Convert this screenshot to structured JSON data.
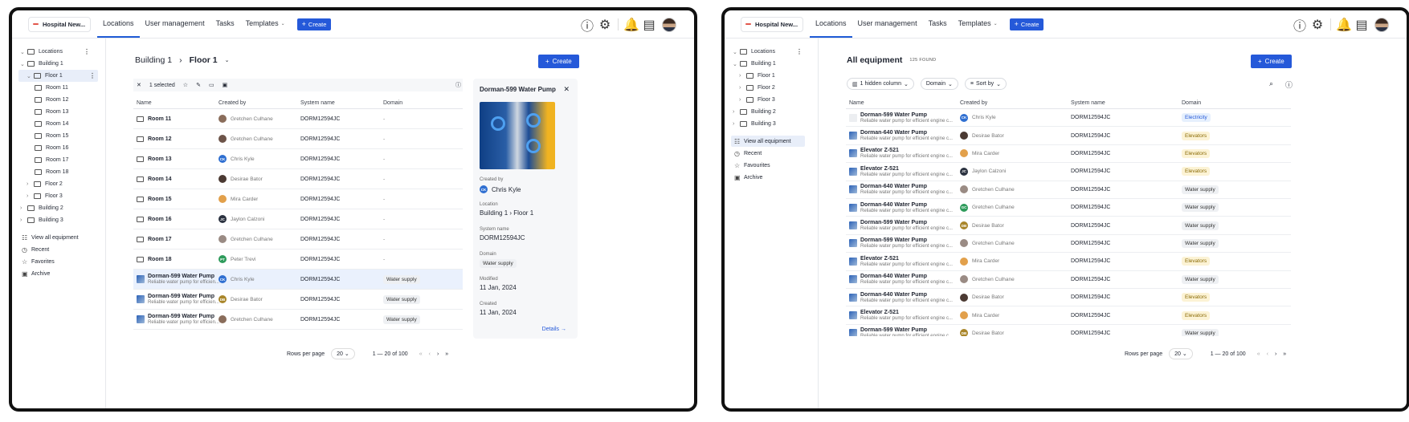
{
  "brand": "Hospital New...",
  "nav": [
    {
      "label": "Locations"
    },
    {
      "label": "User management"
    },
    {
      "label": "Tasks"
    },
    {
      "label": "Templates"
    }
  ],
  "create_label": "Create",
  "left": {
    "tree": {
      "root": "Locations",
      "b1": "Building 1",
      "f1": "Floor 1",
      "rooms": [
        "Room 11",
        "Room 12",
        "Room 13",
        "Room 14",
        "Room 15",
        "Room 16",
        "Room 17",
        "Room 18"
      ],
      "f2": "Floor 2",
      "f3": "Floor 3",
      "b2": "Building 2",
      "b3": "Building 3"
    },
    "side_items": [
      "View all equipment",
      "Recent",
      "Favorites",
      "Archive"
    ],
    "breadcrumb": {
      "a": "Building 1",
      "b": "Floor 1"
    },
    "toolbar": {
      "selected": "1 selected"
    },
    "columns": [
      "Name",
      "Created by",
      "System name",
      "Domain"
    ],
    "rows": [
      {
        "name": "Room 11",
        "sub": "",
        "by": "Gretchen Culhane",
        "sys": "DORM12594JC",
        "domain": "-",
        "kind": "folder",
        "init": "",
        "col": "#8a6d5b"
      },
      {
        "name": "Room 12",
        "sub": "",
        "by": "Gretchen Culhane",
        "sys": "DORM12594JC",
        "domain": "-",
        "kind": "folder",
        "init": "",
        "col": "#6d5449"
      },
      {
        "name": "Room 13",
        "sub": "",
        "by": "Chris Kyle",
        "sys": "DORM12594JC",
        "domain": "-",
        "kind": "folder",
        "init": "CK",
        "col": "#2f6fd1"
      },
      {
        "name": "Room 14",
        "sub": "",
        "by": "Desirae Bator",
        "sys": "DORM12594JC",
        "domain": "-",
        "kind": "folder",
        "init": "",
        "col": "#4b3a33"
      },
      {
        "name": "Room 15",
        "sub": "",
        "by": "Mira Carder",
        "sys": "DORM12594JC",
        "domain": "-",
        "kind": "folder",
        "init": "",
        "col": "#e2a04b"
      },
      {
        "name": "Room 16",
        "sub": "",
        "by": "Jaylon Calzoni",
        "sys": "DORM12594JC",
        "domain": "-",
        "kind": "folder",
        "init": "JC",
        "col": "#2b3240"
      },
      {
        "name": "Room 17",
        "sub": "",
        "by": "Gretchen Culhane",
        "sys": "DORM12594JC",
        "domain": "-",
        "kind": "folder",
        "init": "",
        "col": "#9a8b84"
      },
      {
        "name": "Room 18",
        "sub": "",
        "by": "Peter Trevi",
        "sys": "DORM12594JC",
        "domain": "-",
        "kind": "folder",
        "init": "PT",
        "col": "#2e9b5b"
      },
      {
        "name": "Dorman-599 Water Pump",
        "sub": "Reliable water pump for efficien...",
        "by": "Chris Kyle",
        "sys": "DORM12594JC",
        "domain": "Water supply",
        "kind": "thumb",
        "init": "CK",
        "col": "#2f6fd1"
      },
      {
        "name": "Dorman-599 Water Pump",
        "sub": "Reliable water pump for efficien...",
        "by": "Desirae Bator",
        "sys": "DORM12594JC",
        "domain": "Water supply",
        "kind": "thumb",
        "init": "DB",
        "col": "#a9862a"
      },
      {
        "name": "Dorman-599 Water Pump",
        "sub": "Reliable water pump for efficien...",
        "by": "Gretchen Culhane",
        "sys": "DORM12594JC",
        "domain": "Water supply",
        "kind": "thumb",
        "init": "",
        "col": "#8a6d5b"
      }
    ],
    "panel": {
      "title": "Dorman-599 Water Pump",
      "created_by_label": "Created by",
      "created_by": "Chris Kyle",
      "created_init": "CK",
      "location_label": "Location",
      "location": "Building 1 › Floor 1",
      "sys_label": "System name",
      "sys": "DORM12594JC",
      "domain_label": "Domain",
      "domain": "Water supply",
      "modified_label": "Modified",
      "modified": "11 Jan, 2024",
      "created_label": "Created",
      "created": "11 Jan, 2024",
      "details": "Details →"
    },
    "pager": {
      "rows_label": "Rows per page",
      "rows": "20",
      "range": "1 — 20 of 100"
    }
  },
  "right": {
    "tree": {
      "root": "Locations",
      "b1": "Building 1",
      "floors": [
        "Floor 1",
        "Floor 2",
        "Floor 3"
      ],
      "b2": "Building 2",
      "b3": "Building 3"
    },
    "side_items": [
      "View all equipment",
      "Recent",
      "Favourites",
      "Archive"
    ],
    "title": "All equipment",
    "count": "125 FOUND",
    "filters": [
      "1 hidden column",
      "Domain",
      "Sort by"
    ],
    "columns": [
      "Name",
      "Created by",
      "System name",
      "Domain"
    ],
    "rows": [
      {
        "name": "Dorman-599 Water Pump",
        "sub": "Reliable water pump for efficient engine c...",
        "by": "Chris Kyle",
        "init": "CK",
        "col": "#2f6fd1",
        "sys": "DORM12594JC",
        "domain": "Electricity",
        "t": "el",
        "th": "dots"
      },
      {
        "name": "Dorman-640 Water Pump",
        "sub": "Reliable water pump for efficient engine c...",
        "by": "Desirae Bator",
        "init": "",
        "col": "#4b3a33",
        "sys": "DORM12594JC",
        "domain": "Elevators",
        "t": "ev",
        "th": "img"
      },
      {
        "name": "Elevator Z-521",
        "sub": "Reliable water pump for efficient engine c...",
        "by": "Mira Carder",
        "init": "",
        "col": "#e2a04b",
        "sys": "DORM12594JC",
        "domain": "Elevators",
        "t": "ev",
        "th": "img"
      },
      {
        "name": "Elevator Z-521",
        "sub": "Reliable water pump for efficient engine c...",
        "by": "Jaylon Calzoni",
        "init": "JC",
        "col": "#2b3240",
        "sys": "DORM12594JC",
        "domain": "Elevators",
        "t": "ev",
        "th": "img"
      },
      {
        "name": "Dorman-640 Water Pump",
        "sub": "Reliable water pump for efficient engine c...",
        "by": "Gretchen Culhane",
        "init": "",
        "col": "#9a8b84",
        "sys": "DORM12594JC",
        "domain": "Water supply",
        "t": "ws",
        "th": "img"
      },
      {
        "name": "Dorman-640 Water Pump",
        "sub": "Reliable water pump for efficient engine c...",
        "by": "Gretchen Culhane",
        "init": "GC",
        "col": "#2e9b5b",
        "sys": "DORM12594JC",
        "domain": "Water supply",
        "t": "ws",
        "th": "img"
      },
      {
        "name": "Dorman-599 Water Pump",
        "sub": "Reliable water pump for efficient engine c...",
        "by": "Desirae Bator",
        "init": "DB",
        "col": "#a9862a",
        "sys": "DORM12594JC",
        "domain": "Water supply",
        "t": "ws",
        "th": "img"
      },
      {
        "name": "Dorman-599 Water Pump",
        "sub": "Reliable water pump for efficient engine c...",
        "by": "Gretchen Culhane",
        "init": "",
        "col": "#9a8b84",
        "sys": "DORM12594JC",
        "domain": "Water supply",
        "t": "ws",
        "th": "img"
      },
      {
        "name": "Elevator Z-521",
        "sub": "Reliable water pump for efficient engine c...",
        "by": "Mira Carder",
        "init": "",
        "col": "#e2a04b",
        "sys": "DORM12594JC",
        "domain": "Elevators",
        "t": "ev",
        "th": "img"
      },
      {
        "name": "Dorman-640 Water Pump",
        "sub": "Reliable water pump for efficient engine c...",
        "by": "Gretchen Culhane",
        "init": "",
        "col": "#9a8b84",
        "sys": "DORM12594JC",
        "domain": "Water supply",
        "t": "ws",
        "th": "img"
      },
      {
        "name": "Dorman-640 Water Pump",
        "sub": "Reliable water pump for efficient engine c...",
        "by": "Desirae Bator",
        "init": "",
        "col": "#4b3a33",
        "sys": "DORM12594JC",
        "domain": "Elevators",
        "t": "ev",
        "th": "img"
      },
      {
        "name": "Elevator Z-521",
        "sub": "Reliable water pump for efficient engine c...",
        "by": "Mira Carder",
        "init": "",
        "col": "#e2a04b",
        "sys": "DORM12594JC",
        "domain": "Elevators",
        "t": "ev",
        "th": "img"
      },
      {
        "name": "Dorman-599 Water Pump",
        "sub": "Reliable water pump for efficient engine c...",
        "by": "Desirae Bator",
        "init": "DB",
        "col": "#a9862a",
        "sys": "DORM12594JC",
        "domain": "Water supply",
        "t": "ws",
        "th": "img"
      }
    ],
    "pager": {
      "rows_label": "Rows per page",
      "rows": "20",
      "range": "1 — 20 of 100"
    }
  }
}
